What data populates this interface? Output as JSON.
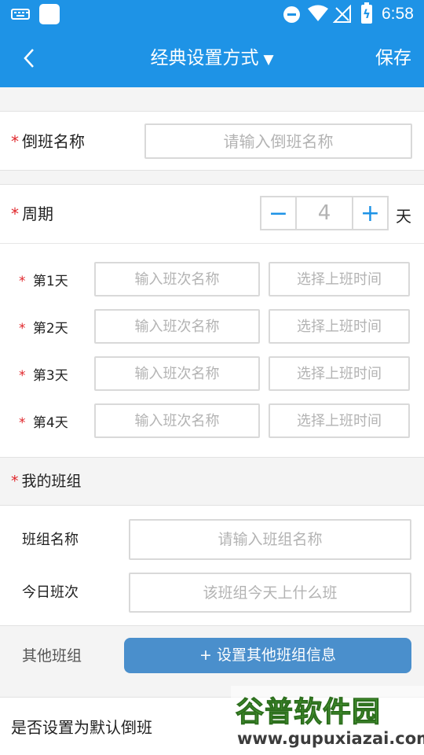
{
  "status_bar": {
    "time": "6:58",
    "icons": [
      "keyboard-icon",
      "app-notification-icon",
      "do-not-disturb-icon",
      "wifi-icon",
      "no-signal-icon",
      "battery-charging-icon"
    ]
  },
  "header": {
    "title": "经典设置方式",
    "caret": "▼",
    "save_label": "保存",
    "back_icon": "chevron-left-icon"
  },
  "form": {
    "required_mark": "*",
    "shift_name": {
      "label": "倒班名称",
      "placeholder": "请输入倒班名称"
    },
    "cycle": {
      "label": "周期",
      "minus": "−",
      "plus": "+",
      "value": "4",
      "unit": "天"
    },
    "days": [
      {
        "label": "第1天",
        "name_placeholder": "输入班次名称",
        "time_placeholder": "选择上班时间"
      },
      {
        "label": "第2天",
        "name_placeholder": "输入班次名称",
        "time_placeholder": "选择上班时间"
      },
      {
        "label": "第3天",
        "name_placeholder": "输入班次名称",
        "time_placeholder": "选择上班时间"
      },
      {
        "label": "第4天",
        "name_placeholder": "输入班次名称",
        "time_placeholder": "选择上班时间"
      }
    ],
    "my_group": {
      "title": "我的班组",
      "group_name": {
        "label": "班组名称",
        "placeholder": "请输入班组名称"
      },
      "today_shift": {
        "label": "今日班次",
        "placeholder": "该班组今天上什么班"
      }
    },
    "other_groups": {
      "label": "其他班组",
      "button": "+ 设置其他班组信息"
    },
    "default_shift": {
      "label": "是否设置为默认倒班"
    }
  },
  "watermark": {
    "logo": "谷普软件园",
    "url": "www.gupuxiazai.com"
  },
  "colors": {
    "primary": "#1e93e6",
    "button": "#4a8fcc",
    "required": "#e0262b",
    "background": "#f4f4f4"
  }
}
